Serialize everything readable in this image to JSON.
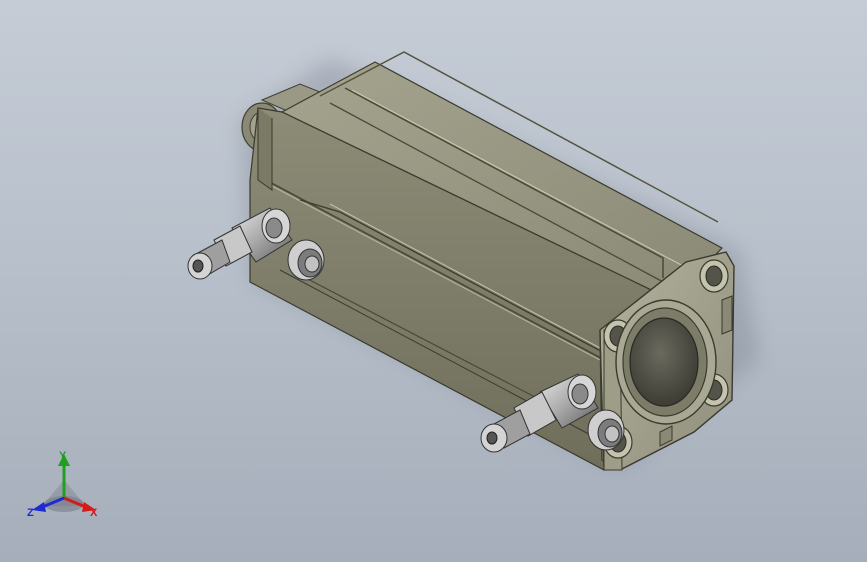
{
  "model": {
    "name": "pneumatic-cylinder",
    "body_color": "#8e8d78",
    "body_light": "#a8a792",
    "body_dark": "#6c6b58",
    "fitting_color": "#b4b4b4",
    "background_top": "#c5ccd6",
    "background_bottom": "#a6aebb"
  },
  "triad": {
    "x_label": "X",
    "y_label": "Y",
    "z_label": "Z",
    "x_color": "#d21c1c",
    "y_color": "#1ea01e",
    "z_color": "#1c2cd2"
  }
}
